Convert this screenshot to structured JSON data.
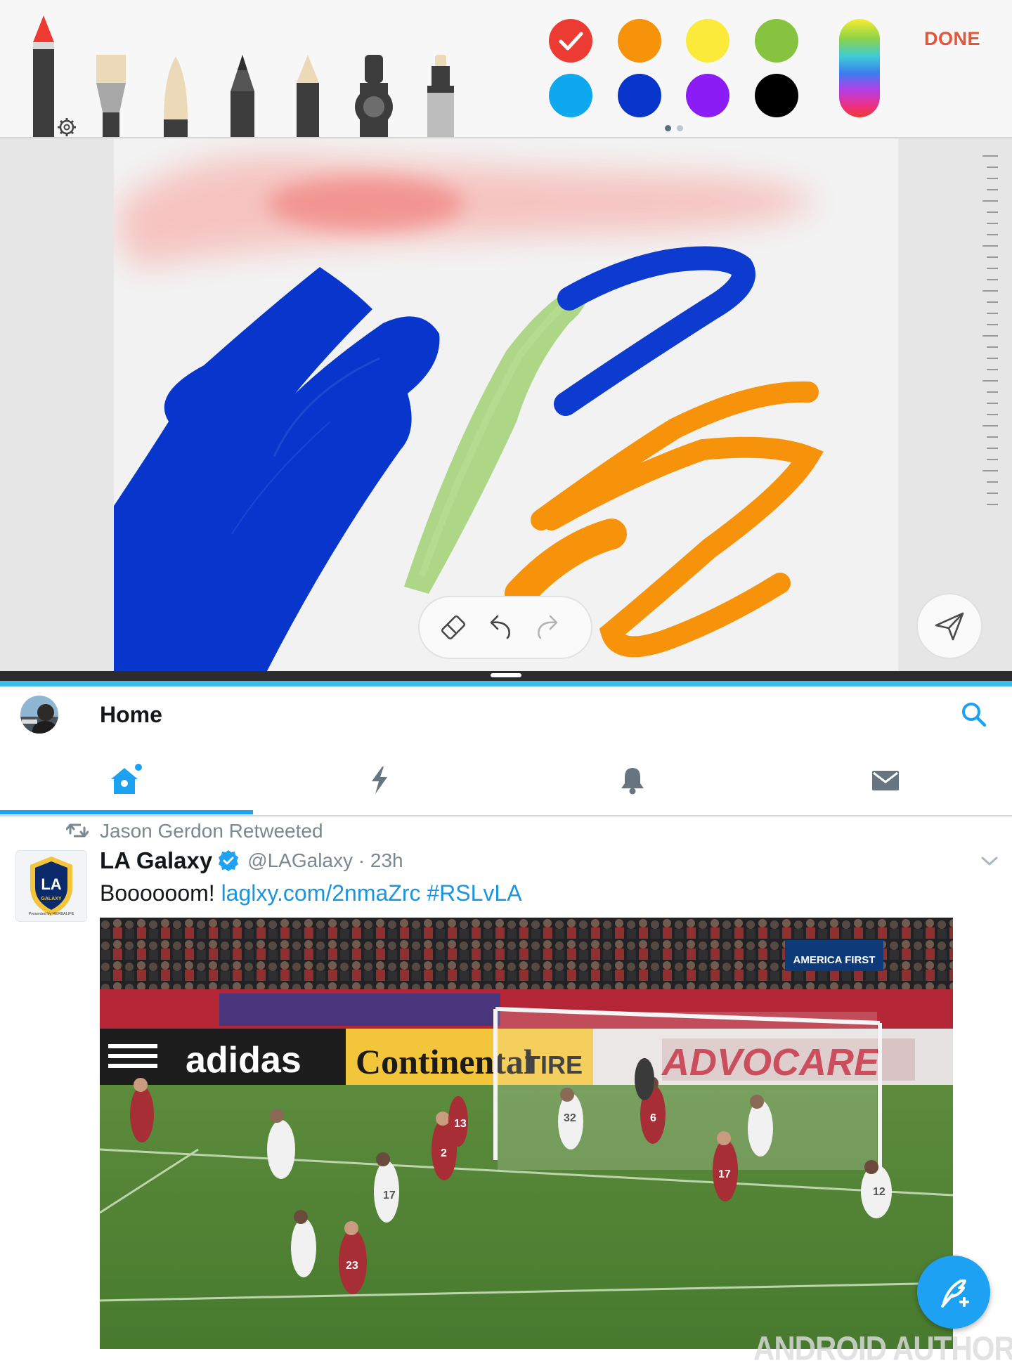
{
  "drawing_app": {
    "done_label": "DONE",
    "tools": [
      "pen-icon",
      "calligraphy-brush-icon",
      "brush-icon",
      "pencil-icon",
      "chalk-icon",
      "marker-icon",
      "highlighter-icon"
    ],
    "colors": {
      "swatches": [
        "#ec3b32",
        "#f6930a",
        "#fbea3a",
        "#86c440",
        "#0ea8ef",
        "#0836cc",
        "#8b1cf5",
        "#000000"
      ],
      "selected": "#ec3b32",
      "spectrum": "color-spectrum-icon"
    },
    "canvas_strokes": [
      {
        "color": "#ec3b32",
        "tool": "watercolor"
      },
      {
        "color": "#0836cc",
        "tool": "oil-brush"
      },
      {
        "color": "#86c440",
        "tool": "chalk"
      },
      {
        "color": "#f6930a",
        "tool": "brush"
      }
    ],
    "edit_icons": [
      "eraser-icon",
      "undo-icon",
      "redo-icon"
    ],
    "send_icon": "send-icon"
  },
  "twitter": {
    "title": "Home",
    "search_icon": "search-icon",
    "tabs": [
      "home-icon",
      "moments-icon",
      "notifications-icon",
      "messages-icon"
    ],
    "active_tab": 0,
    "tweet": {
      "retweeted_by": "Jason Gerdon Retweeted",
      "name": "LA Galaxy",
      "handle": "@LAGalaxy · 23h",
      "text_plain": "Boooooom! ",
      "link": "laglxy.com/2nmaZrc",
      "hashtag": "#RSLvLA",
      "badge_lines": [
        "LA",
        "GALAXY",
        "Presented by HERBALIFE"
      ]
    },
    "media": {
      "signs": [
        "AMERICA FIRST",
        "adidas",
        "Continental",
        "TIRE",
        "ADVOCARE"
      ],
      "jersey_numbers": [
        "32",
        "6",
        "13",
        "2",
        "17",
        "23",
        "17",
        "12"
      ]
    },
    "compose_icon": "compose-tweet-icon"
  },
  "watermark": "ANDROID AUTHORITY"
}
